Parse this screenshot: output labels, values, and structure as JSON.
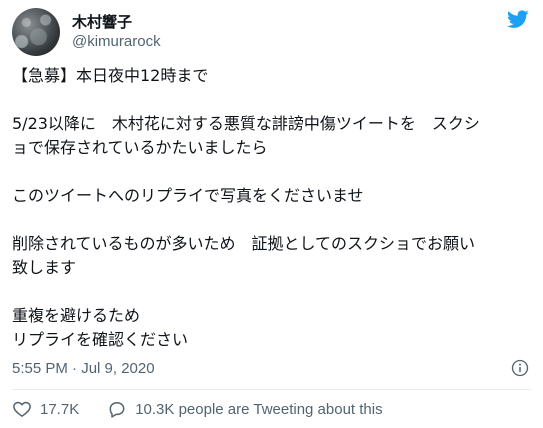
{
  "author": {
    "display_name": "木村響子",
    "handle": "@kimurarock"
  },
  "tweet": {
    "lines": [
      "【急募】本日夜中12時まで",
      "",
      "5/23以降に　木村花に対する悪質な誹謗中傷ツイートを　スクシ",
      "ョで保存されているかたいましたら",
      "",
      "このツイートへのリプライで写真をくださいませ",
      "",
      "削除されているものが多いため　証拠としてのスクショでお願い",
      "致します",
      "",
      "重複を避けるため",
      "リプライを確認ください"
    ]
  },
  "meta": {
    "timestamp": "5:55 PM · Jul 9, 2020"
  },
  "actions": {
    "likes": "17.7K",
    "replies_text": "10.3K people are Tweeting about this"
  },
  "colors": {
    "brand": "#1da1f2",
    "text": "#0f1419",
    "secondary": "#536471",
    "divider": "#e6ecf0"
  },
  "icons": {
    "logo": "twitter-bird-icon",
    "info": "info-circle-icon",
    "like": "heart-icon",
    "reply": "speech-bubble-icon"
  }
}
